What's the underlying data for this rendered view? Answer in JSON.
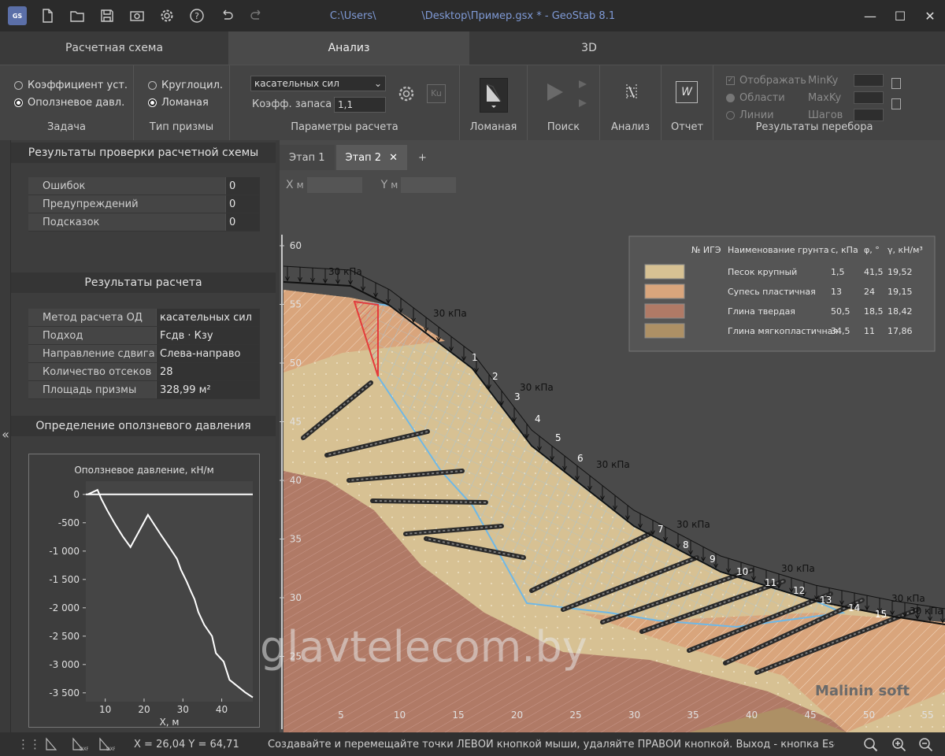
{
  "window": {
    "title_path": "C:\\Users\\",
    "title_file": "\\Desktop\\Пример.gsx * - GeoStab 8.1",
    "app_badge": "GS"
  },
  "tabs": [
    "Расчетная схема",
    "Анализ",
    "3D"
  ],
  "ribbon": {
    "task": {
      "label": "Задача",
      "opt1": "Коэффициент уст.",
      "opt2": "Оползневое давл."
    },
    "prism": {
      "label": "Тип призмы",
      "opt1": "Круглоцил.",
      "opt2": "Ломаная"
    },
    "params": {
      "label": "Параметры расчета",
      "method": "касательных сил",
      "safety_label": "Коэфф. запаса",
      "safety_value": "1,1",
      "ku_label": "Ku"
    },
    "btn_broken": "Ломаная",
    "btn_search": "Поиск",
    "btn_analysis": "Анализ",
    "btn_report": "Отчет",
    "enum": {
      "label": "Результаты перебора",
      "show": "Отображать",
      "areas": "Области",
      "lines": "Линии",
      "minku": "MinKy",
      "maxku": "MaxKy",
      "steps": "Шагов"
    }
  },
  "check": {
    "title": "Результаты проверки расчетной схемы",
    "rows": [
      [
        "Ошибок",
        "0"
      ],
      [
        "Предупреждений",
        "0"
      ],
      [
        "Подсказок",
        "0"
      ]
    ]
  },
  "results": {
    "title": "Результаты расчета",
    "rows": [
      [
        "Метод расчета ОД",
        "касательных сил"
      ],
      [
        "Подход",
        "Fсдв · Кзу"
      ],
      [
        "Направление сдвига",
        "Слева-направо"
      ],
      [
        "Количество отсеков",
        "28"
      ],
      [
        "Площадь призмы",
        "328,99 м²"
      ]
    ]
  },
  "pressure": {
    "title": "Определение оползневого давления",
    "chart_data": {
      "type": "line",
      "title": "Оползневое давление, кН/м",
      "xlabel": "X, м",
      "ylabel": "",
      "xlim": [
        5,
        48
      ],
      "ylim": [
        -3600,
        150
      ],
      "xticks": [
        10,
        20,
        30,
        40
      ],
      "yticks": [
        0,
        -500,
        -1000,
        -1500,
        -2000,
        -2500,
        -3000,
        -3500
      ],
      "ytick_labels": [
        "0",
        "-500",
        "-1 000",
        "-1 500",
        "-2 000",
        "-2 500",
        "-3 000",
        "-3 500"
      ],
      "series": [
        {
          "x": [
            5.5,
            8,
            9,
            10.5,
            12.5,
            14.5,
            16.5,
            21,
            22.5,
            24.5,
            26.5,
            28.5,
            29.5,
            31,
            32,
            33,
            34,
            35.5,
            37.5,
            38.5,
            40.5,
            42,
            46,
            48
          ],
          "y": [
            0,
            80,
            -80,
            -280,
            -520,
            -740,
            -930,
            -360,
            -520,
            -730,
            -930,
            -1140,
            -1330,
            -1540,
            -1700,
            -1850,
            -2080,
            -2300,
            -2500,
            -2800,
            -2950,
            -3270,
            -3490,
            -3580
          ]
        }
      ]
    }
  },
  "stages": [
    "Этап 1",
    "Этап 2"
  ],
  "coords": {
    "x_label": "X",
    "y_label": "Y",
    "unit": "м"
  },
  "section": {
    "y_ticks": [
      "60",
      "55",
      "50",
      "45",
      "40",
      "35",
      "30",
      "25"
    ],
    "x_ticks": [
      "5",
      "10",
      "15",
      "20",
      "25",
      "30",
      "35",
      "40",
      "45",
      "50",
      "55"
    ],
    "load_label": "30 кПа",
    "block_numbers": [
      "1",
      "2",
      "3",
      "4",
      "5",
      "6",
      "7",
      "8",
      "9",
      "10",
      "11",
      "12",
      "13",
      "14",
      "15"
    ],
    "brand": "Malinin soft"
  },
  "legend": {
    "headers": [
      "№ ИГЭ",
      "Наименование грунта",
      "с, кПа",
      "φ, °",
      "γ, кН/м³"
    ],
    "rows": [
      {
        "name": "Песок крупный",
        "c": "1,5",
        "phi": "41,5",
        "gamma": "19,52",
        "color": "#d7c193"
      },
      {
        "name": "Супесь пластичная",
        "c": "13",
        "phi": "24",
        "gamma": "19,15",
        "color": "#d9a57c"
      },
      {
        "name": "Глина твердая",
        "c": "50,5",
        "phi": "18,5",
        "gamma": "18,42",
        "color": "#b07a66"
      },
      {
        "name": "Глина мягкопластичная",
        "c": "34,5",
        "phi": "11",
        "gamma": "17,86",
        "color": "#ad9065"
      }
    ]
  },
  "status": {
    "coords": "X = 26,04  Y = 64,71",
    "message": "Создавайте и перемещайте точки ЛЕВОЙ кнопкой мыши, удаляйте ПРАВОЙ кнопкой. Выход - кнопка Esc клави"
  },
  "watermark": "glavtelecom.by"
}
